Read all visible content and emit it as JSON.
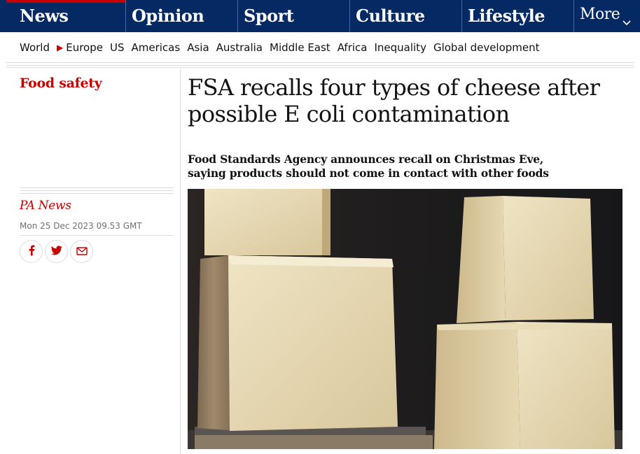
{
  "nav": {
    "pillars": [
      {
        "label": "News"
      },
      {
        "label": "Opinion"
      },
      {
        "label": "Sport"
      },
      {
        "label": "Culture"
      },
      {
        "label": "Lifestyle"
      }
    ],
    "more_label": "More",
    "sub": [
      "World",
      "Europe",
      "US",
      "Americas",
      "Asia",
      "Australia",
      "Middle East",
      "Africa",
      "Inequality",
      "Global development"
    ],
    "accent": "#c70000",
    "background": "#052962"
  },
  "article": {
    "section": "Food safety",
    "headline": "FSA recalls four types of cheese after possible E coli contamination",
    "standfirst": "Food Standards Agency announces recall on Christmas Eve, saying products should not come in contact with other foods",
    "byline": "PA News",
    "date": "Mon 25 Dec 2023 09.53 GMT",
    "share": [
      {
        "icon": "facebook-icon"
      },
      {
        "icon": "twitter-icon"
      },
      {
        "icon": "email-icon"
      }
    ],
    "image_subject": "cheese-blocks"
  }
}
